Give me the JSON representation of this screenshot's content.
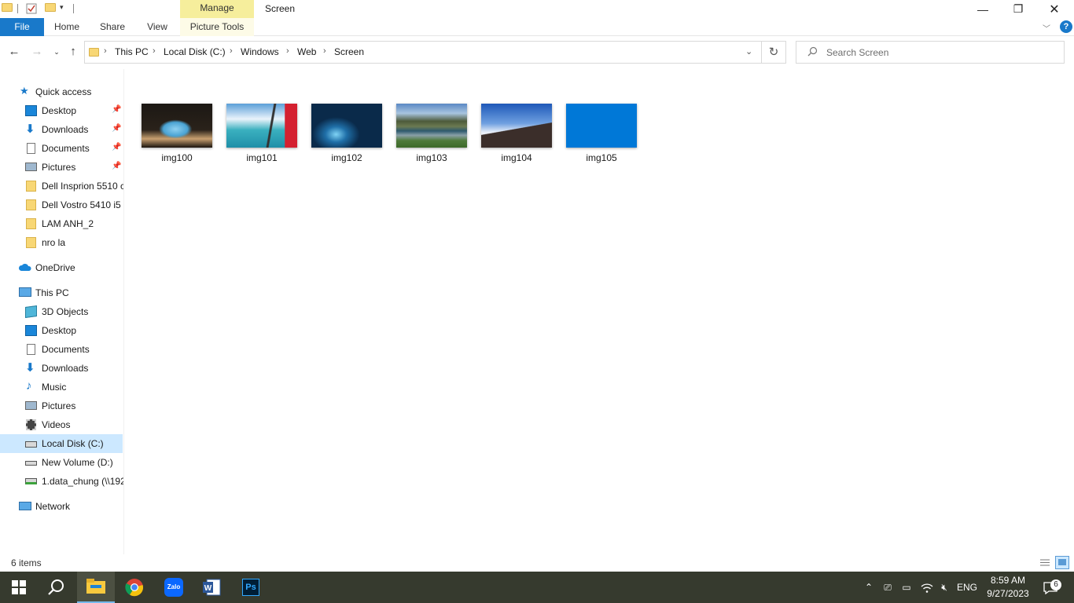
{
  "window": {
    "title": "Screen",
    "manage_label": "Manage",
    "minimize": "—",
    "maximize": "❐",
    "close": "✕"
  },
  "ribbon": {
    "tabs": [
      "File",
      "Home",
      "Share",
      "View",
      "Picture Tools"
    ],
    "help": "?"
  },
  "address": {
    "crumbs": [
      "This PC",
      "Local Disk (C:)",
      "Windows",
      "Web",
      "Screen"
    ]
  },
  "search": {
    "placeholder": "Search Screen"
  },
  "nav": {
    "quick_access": "Quick access",
    "quick_items": [
      "Desktop",
      "Downloads",
      "Documents",
      "Pictures",
      "Dell Insprion 5510 c",
      "Dell Vostro 5410 i5",
      "LAM ANH_2",
      "nro la"
    ],
    "onedrive": "OneDrive",
    "this_pc": "This PC",
    "pc_items": [
      "3D Objects",
      "Desktop",
      "Documents",
      "Downloads",
      "Music",
      "Pictures",
      "Videos",
      "Local Disk (C:)",
      "New Volume (D:)",
      "1.data_chung (\\\\192"
    ],
    "network": "Network"
  },
  "files": [
    {
      "name": "img100"
    },
    {
      "name": "img101"
    },
    {
      "name": "img102"
    },
    {
      "name": "img103"
    },
    {
      "name": "img104"
    },
    {
      "name": "img105"
    }
  ],
  "status": {
    "count": "6 items"
  },
  "taskbar": {
    "lang": "ENG",
    "time": "8:59 AM",
    "date": "9/27/2023",
    "notifications": "6",
    "zalo": "Zalo",
    "ps": "Ps"
  },
  "colors": {
    "accent": "#1979ca",
    "selection": "#cce8ff",
    "taskbar": "#363a2e"
  }
}
